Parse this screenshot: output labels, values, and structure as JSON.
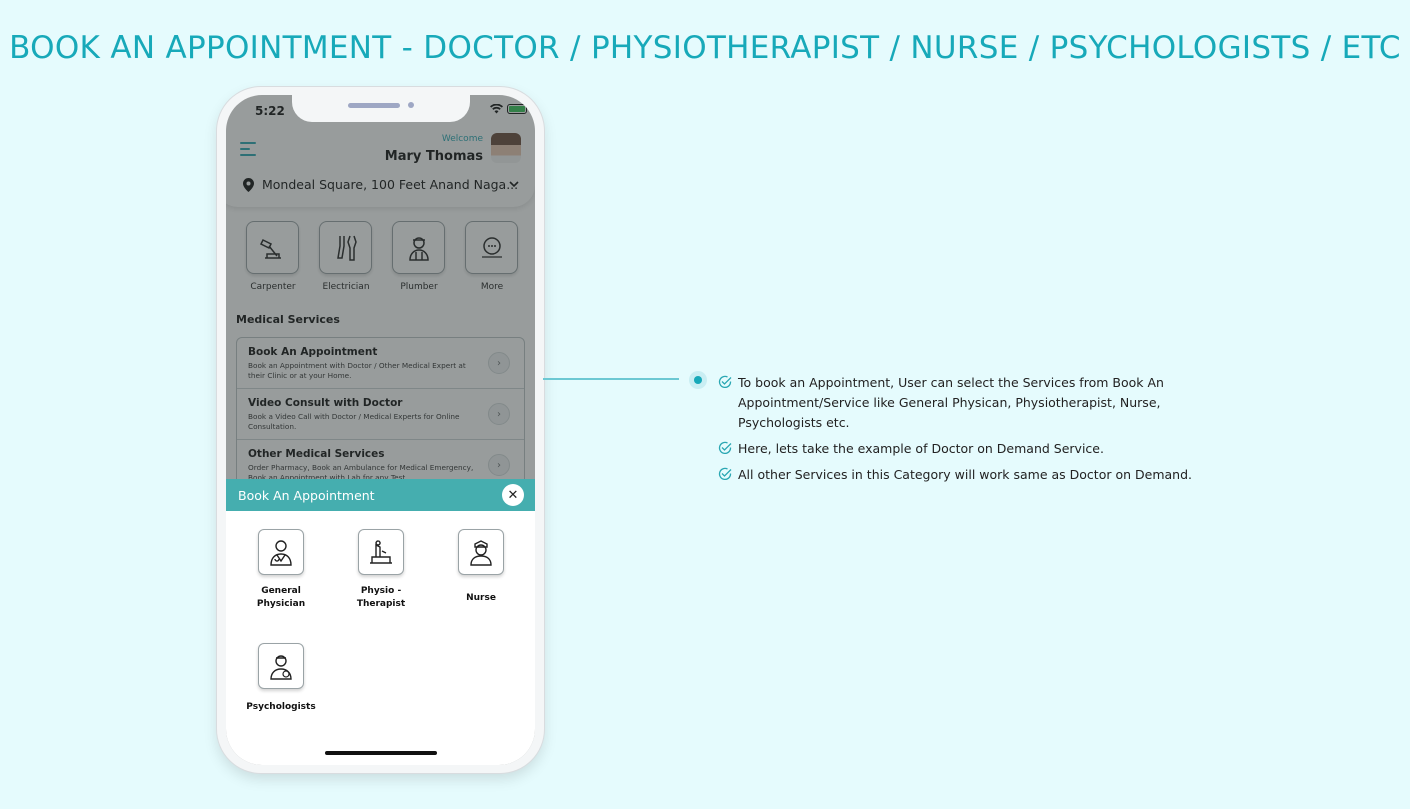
{
  "page": {
    "title": "BOOK AN APPOINTMENT - DOCTOR / PHYSIOTHERAPIST / NURSE / PSYCHOLOGISTS / ETC",
    "accent_color": "#17a9b9",
    "background_color": "#e5fbfd"
  },
  "phone": {
    "status_bar": {
      "time": "5:22"
    },
    "header": {
      "welcome_label": "Welcome",
      "user_name": "Mary Thomas",
      "location": "Mondeal Square, 100 Feet Anand Naga..."
    },
    "home_services": [
      {
        "label": "Carpenter",
        "icon": "carpenter-icon"
      },
      {
        "label": "Electrician",
        "icon": "electrician-icon"
      },
      {
        "label": "Plumber",
        "icon": "plumber-icon"
      },
      {
        "label": "More",
        "icon": "more-icon"
      }
    ],
    "medical_section": {
      "title": "Medical Services",
      "items": [
        {
          "title": "Book An Appointment",
          "desc": "Book an Appointment with Doctor / Other Medical Expert at their Clinic or at your Home."
        },
        {
          "title": "Video Consult with Doctor",
          "desc": "Book a Video Call with Doctor / Medical Experts for Online Consultation."
        },
        {
          "title": "Other Medical Services",
          "desc": "Order Pharmacy, Book an Ambulance for Medical Emergency, Book an Appointment with Lab for any Test..."
        }
      ]
    },
    "sheet": {
      "title": "Book An Appointment",
      "header_color": "#45aeaf",
      "options": [
        {
          "label_line1": "General",
          "label_line2": "Physician",
          "icon": "doctor-icon"
        },
        {
          "label_line1": "Physio -",
          "label_line2": "Therapist",
          "icon": "physio-icon"
        },
        {
          "label_line1": "Nurse",
          "label_line2": "",
          "icon": "nurse-icon"
        },
        {
          "label_line1": "Psychologists",
          "label_line2": "",
          "icon": "psychologist-icon"
        }
      ]
    }
  },
  "notes": [
    "To book an Appointment, User can select the Services from Book An Appointment/Service like General Physican, Physiotherapist, Nurse, Psychologists etc.",
    "Here, lets take the example of Doctor on Demand Service.",
    "All other Services in this Category will work same as Doctor on Demand."
  ]
}
